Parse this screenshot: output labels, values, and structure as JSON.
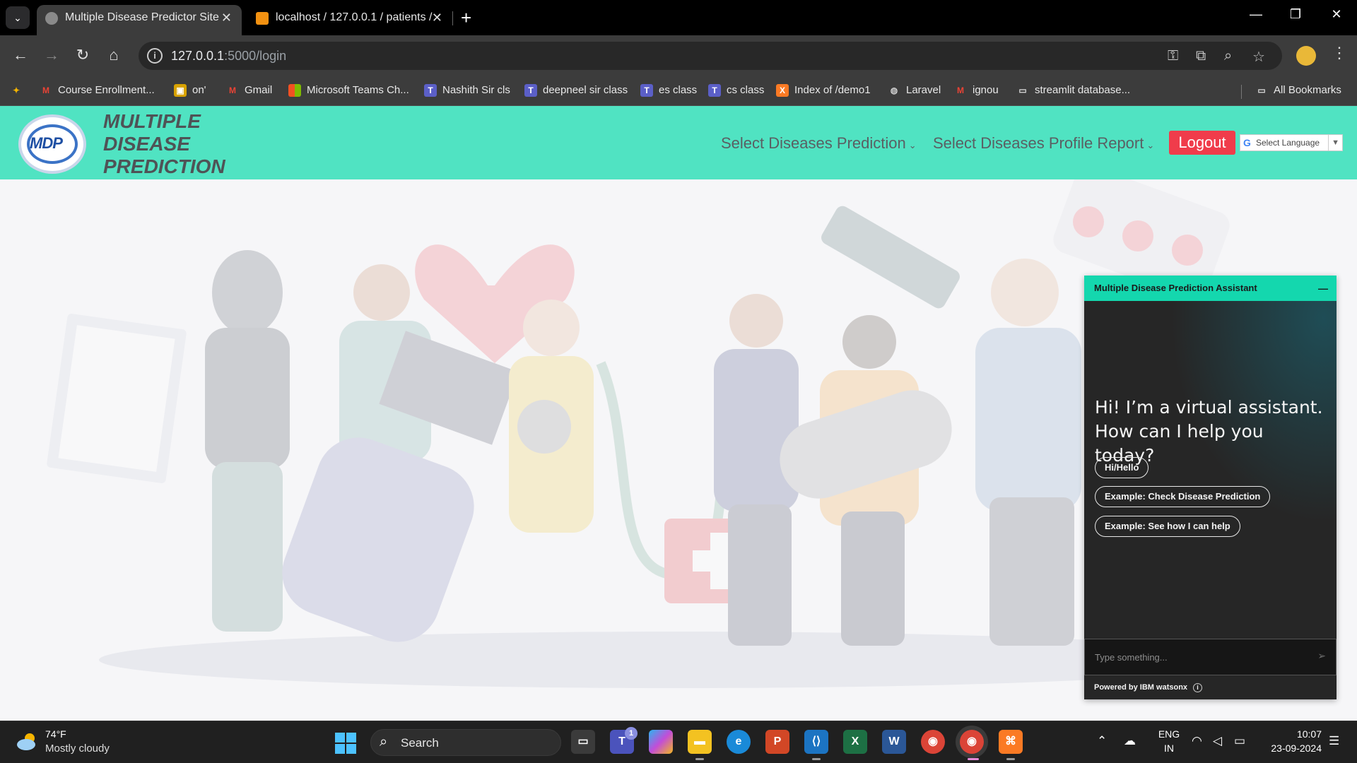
{
  "browser": {
    "tabs": [
      {
        "title": "Multiple Disease Predictor Site",
        "active": true
      },
      {
        "title": "localhost / 127.0.0.1 / patients /",
        "active": false
      }
    ],
    "url_host": "127.0.0.1",
    "url_path": ":5000/login",
    "bookmarks": [
      {
        "label": "Course Enrollment...",
        "icon": "gmail-icon"
      },
      {
        "label": "on'",
        "icon": "bus-icon"
      },
      {
        "label": "Gmail",
        "icon": "gmail-icon"
      },
      {
        "label": "Microsoft Teams Ch...",
        "icon": "microsoft-icon"
      },
      {
        "label": "Nashith Sir cls",
        "icon": "teams-icon"
      },
      {
        "label": "deepneel sir class",
        "icon": "teams-icon"
      },
      {
        "label": "es class",
        "icon": "teams-icon"
      },
      {
        "label": "cs class",
        "icon": "teams-icon"
      },
      {
        "label": "Index of /demo1",
        "icon": "xampp-icon"
      },
      {
        "label": "Laravel",
        "icon": "globe-icon"
      },
      {
        "label": "ignou",
        "icon": "gmail-icon"
      },
      {
        "label": "streamlit database...",
        "icon": "folder-icon"
      }
    ],
    "all_bookmarks": "All Bookmarks"
  },
  "site": {
    "brand_lines": [
      "MULTIPLE",
      "DISEASE",
      "PREDICTION"
    ],
    "logo_text": "MDP",
    "nav": {
      "diseases_prediction": "Select Diseases Prediction",
      "profile_report": "Select Diseases Profile Report",
      "logout": "Logout",
      "translate": "Select Language"
    }
  },
  "chat": {
    "title": "Multiple Disease Prediction Assistant",
    "greeting": "Hi! I’m a virtual assistant. How can I help you today?",
    "chips": [
      "Hi/Hello",
      "Example: Check Disease Prediction",
      "Example: See how I can help"
    ],
    "input_placeholder": "Type something...",
    "powered_by": "Powered by IBM watsonx"
  },
  "taskbar": {
    "weather_temp": "74°F",
    "weather_desc": "Mostly cloudy",
    "search_label": "Search",
    "teams_badge": "1",
    "lang_top": "ENG",
    "lang_bottom": "IN",
    "time": "10:07",
    "date": "23-09-2024"
  },
  "colors": {
    "navbar": "#50e3c2",
    "logout": "#f03c4b",
    "chat_header": "#14d7ae",
    "chat_bg": "#262626"
  }
}
